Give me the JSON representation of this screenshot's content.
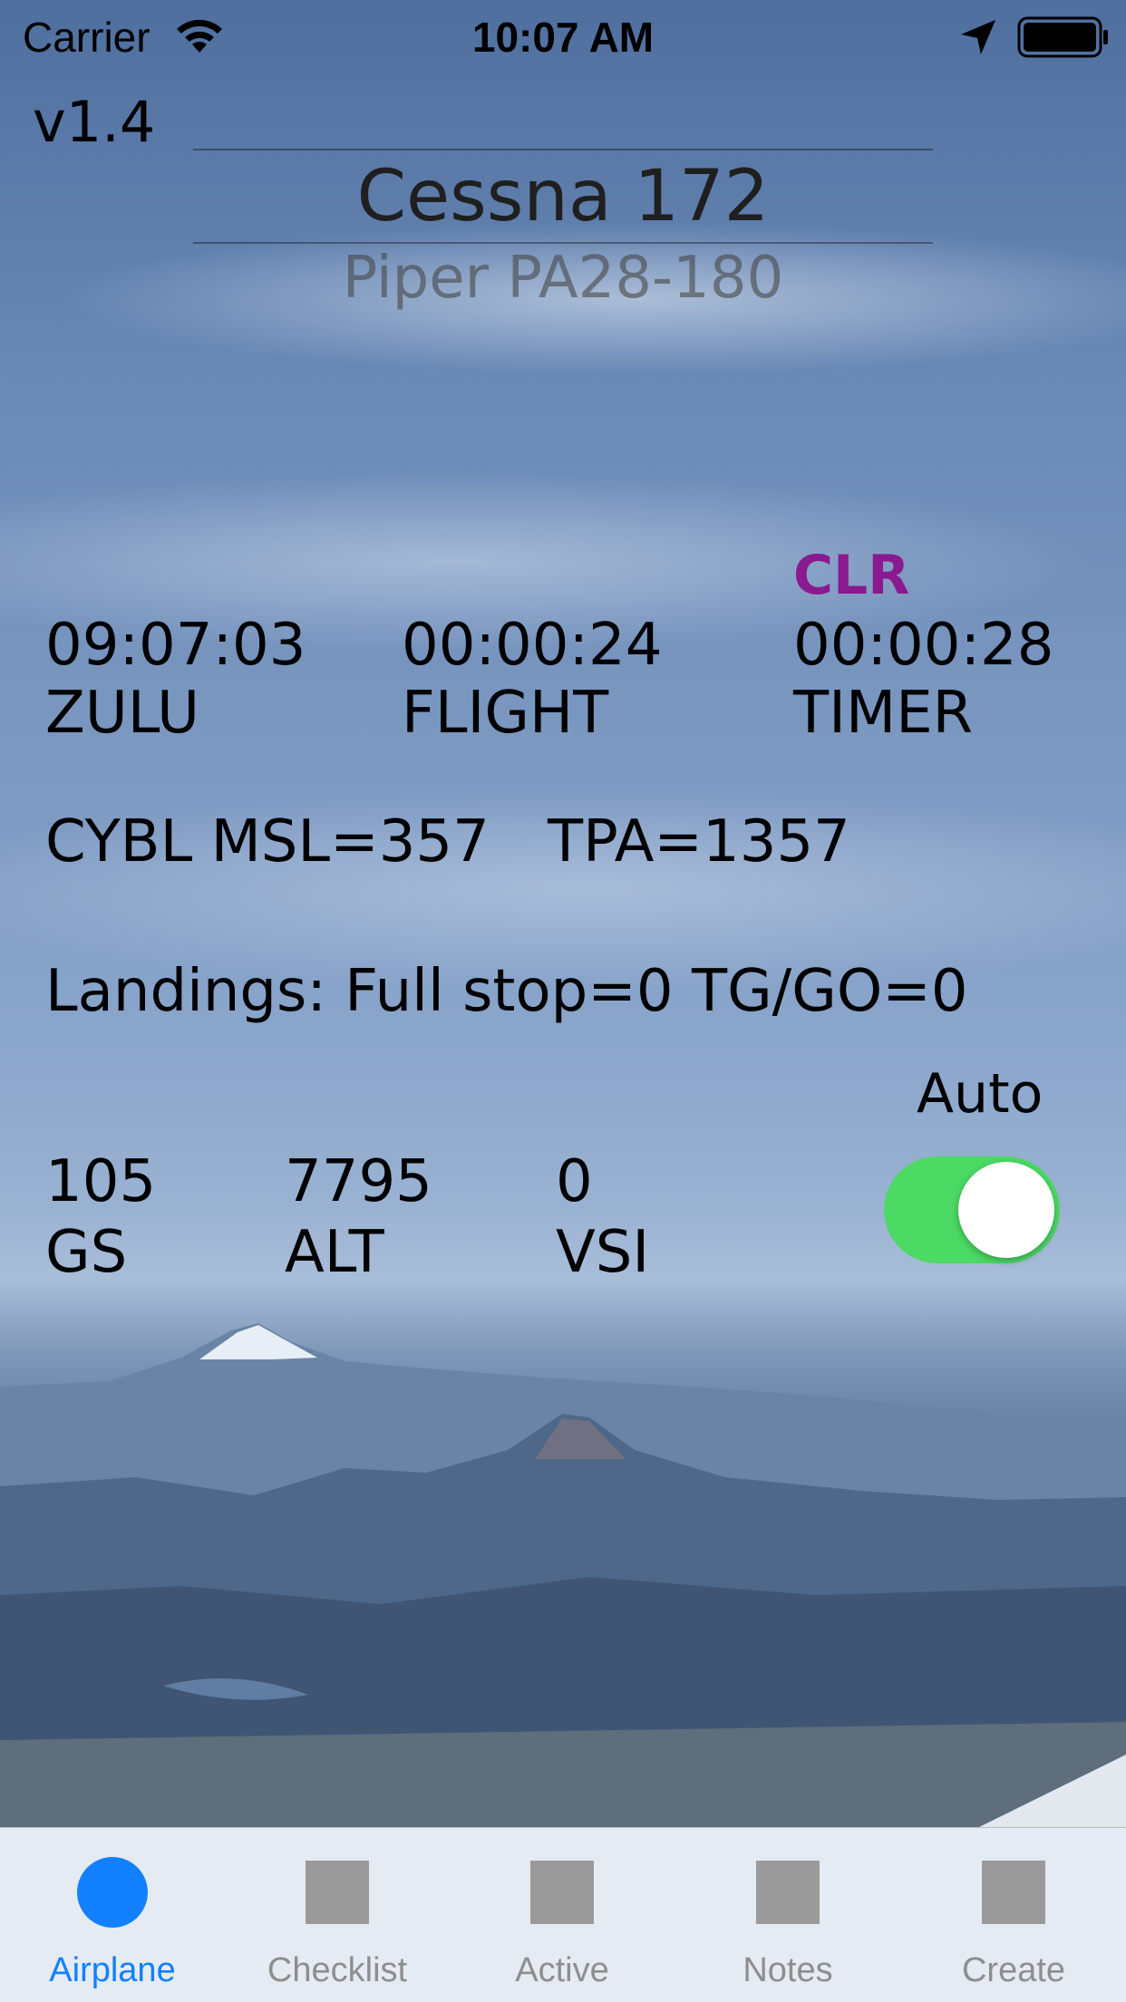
{
  "status_bar": {
    "carrier": "Carrier",
    "time": "10:07 AM",
    "icons": [
      "wifi-icon",
      "location-arrow-icon",
      "battery-icon"
    ]
  },
  "version": "v1.4",
  "aircraft_picker": {
    "selected": "Cessna 172",
    "next": "Piper PA28-180"
  },
  "timers": {
    "clear_label": "CLR",
    "zulu": {
      "value": "09:07:03",
      "label": "ZULU"
    },
    "flight": {
      "value": "00:00:24",
      "label": "FLIGHT"
    },
    "timer": {
      "value": "00:00:28",
      "label": "TIMER"
    }
  },
  "airport": {
    "msl": "CYBL MSL=357",
    "tpa": "TPA=1357"
  },
  "landings": "Landings: Full stop=0 TG/GO=0",
  "instruments": {
    "gs": {
      "value": "105",
      "label": "GS"
    },
    "alt": {
      "value": "7795",
      "label": "ALT"
    },
    "vsi": {
      "value": "0",
      "label": "VSI"
    }
  },
  "auto": {
    "label": "Auto",
    "on": true
  },
  "colors": {
    "clr": "#8a1a8f",
    "toggle_on": "#4cd964",
    "tab_active": "#1380ff",
    "tab_inactive": "#9a9a9a"
  },
  "tab_bar": {
    "tabs": [
      {
        "label": "Airplane",
        "icon": "circle-icon",
        "active": true
      },
      {
        "label": "Checklist",
        "icon": "square-icon",
        "active": false
      },
      {
        "label": "Active",
        "icon": "square-icon",
        "active": false
      },
      {
        "label": "Notes",
        "icon": "square-icon",
        "active": false
      },
      {
        "label": "Create",
        "icon": "square-icon",
        "active": false
      }
    ]
  }
}
